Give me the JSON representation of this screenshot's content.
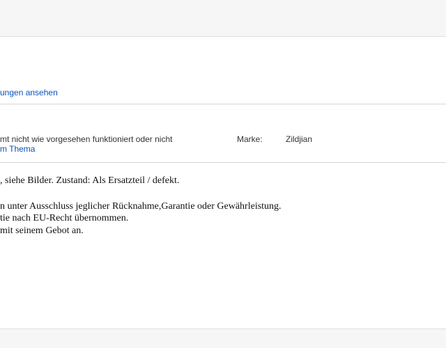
{
  "header": {
    "reviews_link": "ungen ansehen"
  },
  "specifics": {
    "condition_text": "mt nicht wie vorgesehen funktioniert oder nicht",
    "condition_link": "m Thema",
    "brand_label": "Marke:",
    "brand_value": "Zildjian"
  },
  "description": {
    "lines": [
      ", siehe Bilder. Zustand: Als Ersatzteil / defekt.",
      "",
      "n unter Ausschluss jeglicher Rücknahme,Garantie oder Gewährleistung.",
      "tie nach EU-Recht übernommen.",
      " mit seinem Gebot an."
    ]
  }
}
